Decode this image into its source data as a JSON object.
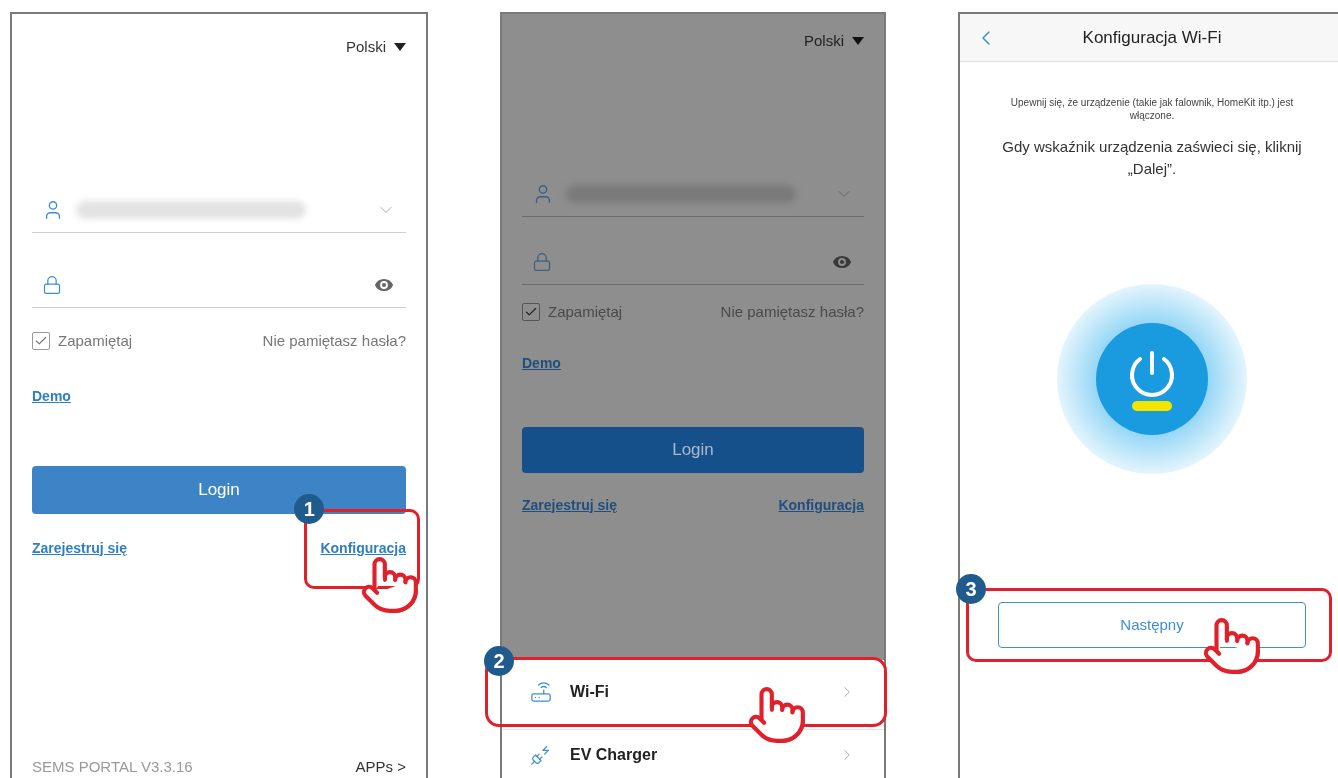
{
  "login_screen": {
    "language": "Polski",
    "remember": {
      "label": "Zapamiętaj",
      "checked": true
    },
    "forgot": "Nie pamiętasz hasła?",
    "demo": "Demo",
    "login": "Login",
    "register": "Zarejestruj się",
    "config": {
      "label": "Konfiguracja",
      "highlighted": true
    },
    "version": "SEMS PORTAL V3.3.16",
    "apps": "APPs >",
    "step": "1"
  },
  "config_menu_screen": {
    "dimmed": true,
    "language": "Polski",
    "remember": {
      "label": "Zapamiętaj",
      "checked": true
    },
    "forgot": "Nie pamiętasz hasła?",
    "demo": "Demo",
    "login": "Login",
    "register": "Zarejestruj się",
    "config": {
      "label": "Konfiguracja",
      "highlighted": false
    },
    "step": "2",
    "menu": [
      {
        "kind": "router",
        "label": "Wi-Fi",
        "highlighted": true
      },
      {
        "kind": "charger",
        "label": "EV Charger",
        "highlighted": false
      }
    ]
  },
  "wifi_screen": {
    "title": "Konfiguracja Wi-Fi",
    "hint": "Upewnij się, że urządzenie (takie jak falownik, HomeKit itp.) jest włączone.",
    "instruction": "Gdy wskaźnik urządzenia zaświeci się, kliknij „Dalej”.",
    "next": {
      "label": "Następny",
      "highlighted": true
    },
    "step": "3"
  }
}
